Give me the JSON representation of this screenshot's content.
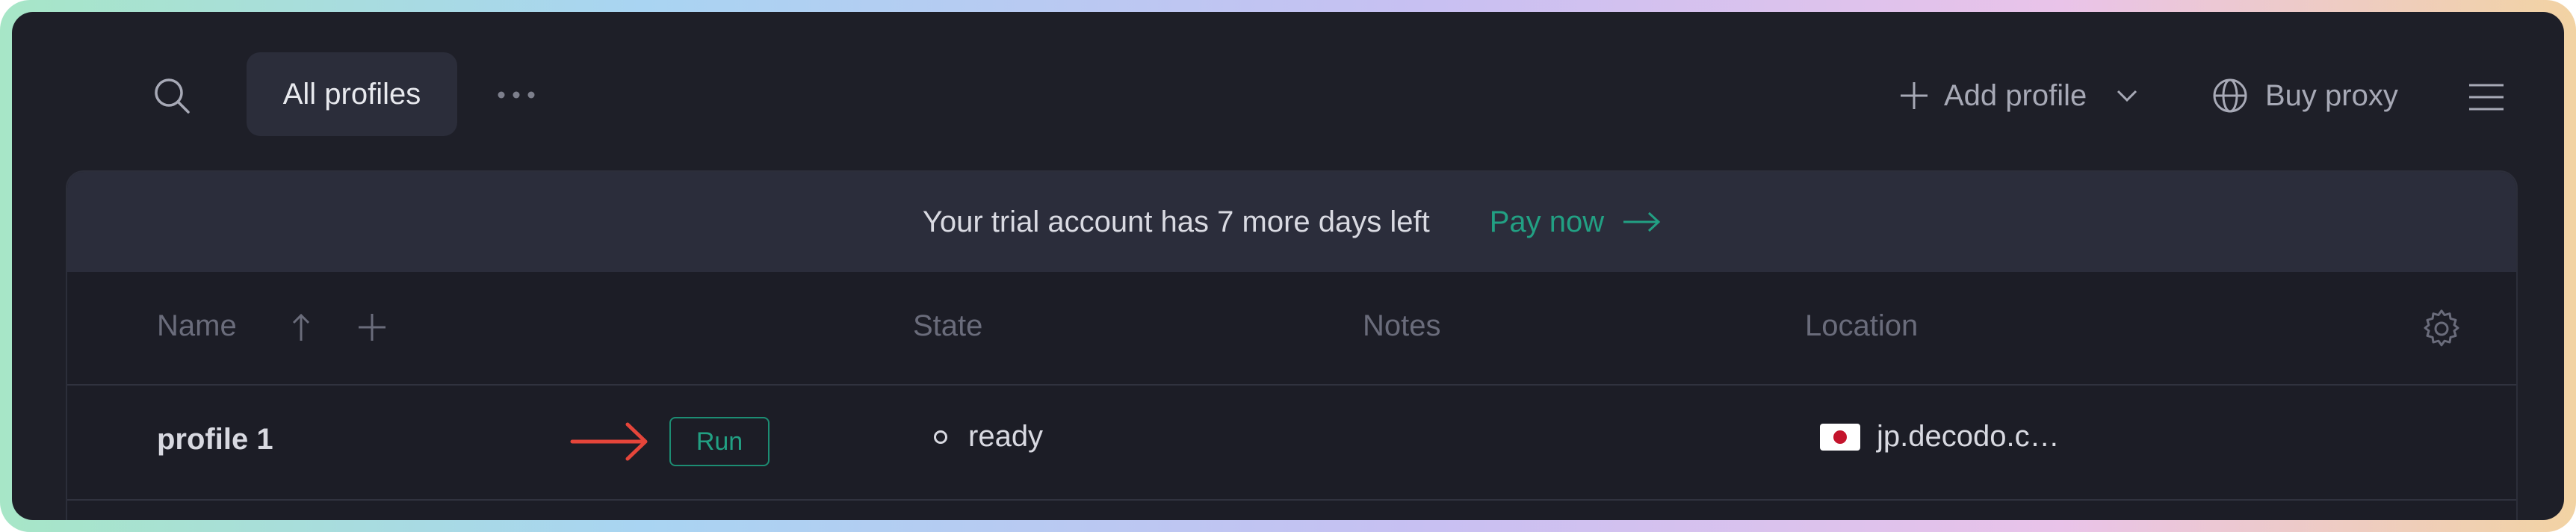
{
  "topbar": {
    "tab_all_profiles": "All profiles",
    "add_profile": "Add profile",
    "buy_proxy": "Buy proxy",
    "icons": [
      "search-icon",
      "more-icon",
      "plus-icon",
      "chevron-down-icon",
      "globe-icon",
      "menu-icon"
    ]
  },
  "banner": {
    "text": "Your trial account has 7 more days left",
    "pay_now": "Pay now"
  },
  "table": {
    "columns": {
      "name": "Name",
      "state": "State",
      "notes": "Notes",
      "location": "Location"
    },
    "rows": [
      {
        "name": "profile 1",
        "run_label": "Run",
        "state": "ready",
        "notes": "",
        "location": "jp.decodo.c…"
      }
    ]
  },
  "colors": {
    "background": "#1e1f28",
    "accent": "#22a083",
    "arrow": "#e5453a"
  }
}
